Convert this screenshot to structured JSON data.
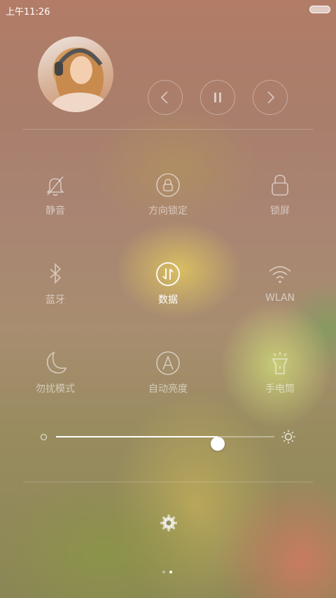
{
  "status_bar": {
    "time": "上午11:26"
  },
  "media": {
    "now_playing_avatar": "album-art"
  },
  "toggles": [
    {
      "id": "mute",
      "label": "静音",
      "icon": "bell-off-icon",
      "active": false
    },
    {
      "id": "rotation",
      "label": "方向锁定",
      "icon": "rotation-lock-icon",
      "active": false
    },
    {
      "id": "lock",
      "label": "锁屏",
      "icon": "lock-icon",
      "active": false
    },
    {
      "id": "bluetooth",
      "label": "蓝牙",
      "icon": "bluetooth-icon",
      "active": false
    },
    {
      "id": "data",
      "label": "数据",
      "icon": "mobile-data-icon",
      "active": true
    },
    {
      "id": "wlan",
      "label": "WLAN",
      "icon": "wifi-icon",
      "active": false
    },
    {
      "id": "dnd",
      "label": "勿扰模式",
      "icon": "moon-icon",
      "active": false
    },
    {
      "id": "auto_brightness",
      "label": "自动亮度",
      "icon": "auto-brightness-icon",
      "active": false
    },
    {
      "id": "flashlight",
      "label": "手电筒",
      "icon": "flashlight-icon",
      "active": false
    }
  ],
  "brightness": {
    "level": 0.74
  },
  "pager": {
    "pages": 2,
    "current": 2
  },
  "colors": {
    "active": "#ffffff",
    "inactive": "rgba(255,255,255,0.55)"
  }
}
